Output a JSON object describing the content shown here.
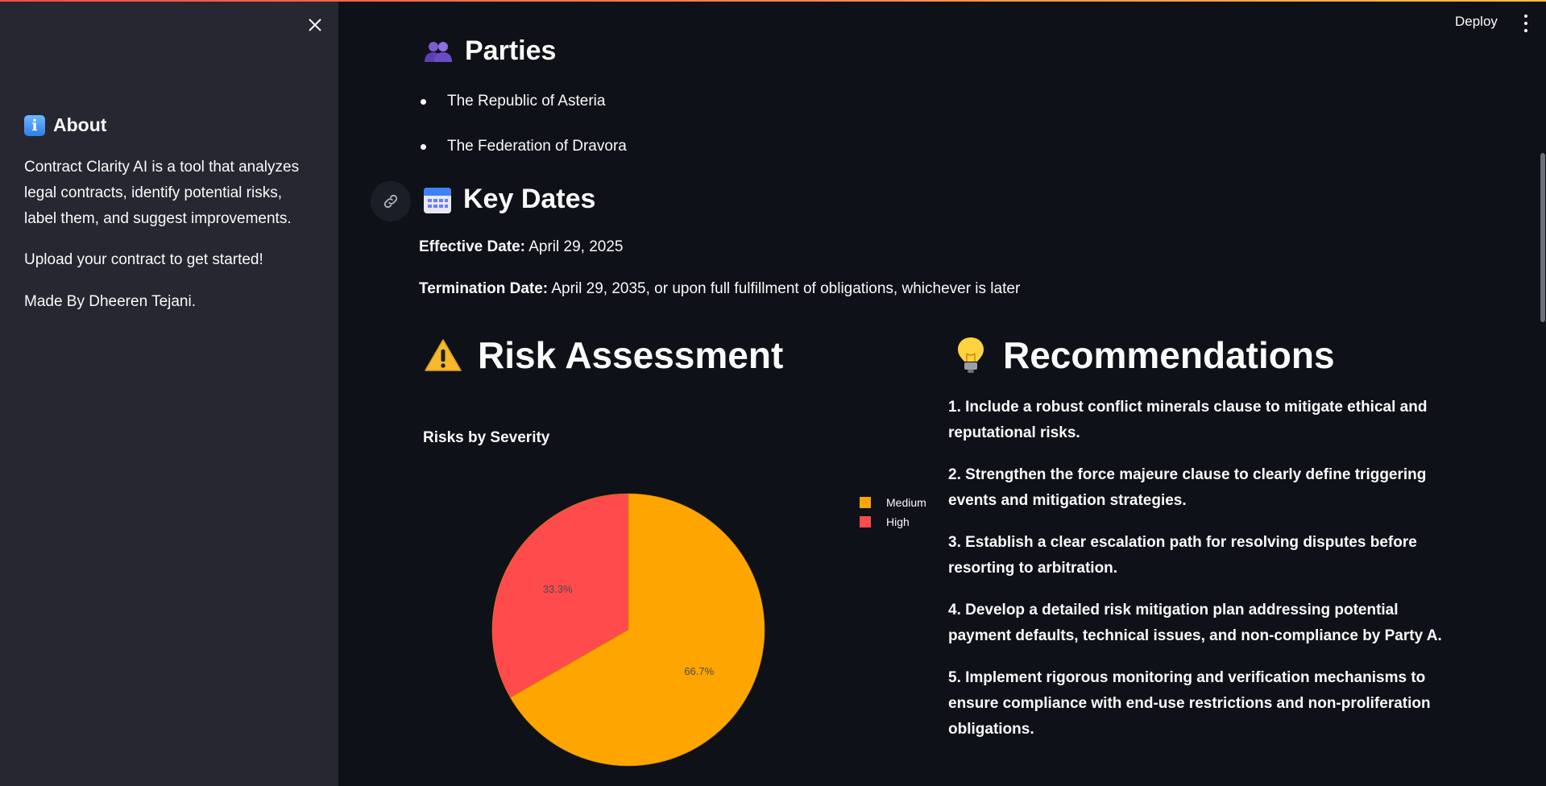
{
  "header": {
    "deploy_label": "Deploy"
  },
  "sidebar": {
    "about_title": "About",
    "description": "Contract Clarity AI is a tool that analyzes legal contracts, identify potential risks, label them, and suggest improvements.",
    "cta": "Upload your contract to get started!",
    "credit": "Made By Dheeren Tejani."
  },
  "parties": {
    "title": "Parties",
    "items": [
      "The Republic of Asteria",
      "The Federation of Dravora"
    ]
  },
  "key_dates": {
    "title": "Key Dates",
    "effective_label": "Effective Date:",
    "effective_value": "April 29, 2025",
    "termination_label": "Termination Date:",
    "termination_value": "April 29, 2035, or upon full fulfillment of obligations, whichever is later"
  },
  "risk": {
    "title": "Risk Assessment"
  },
  "recommendations": {
    "title": "Recommendations",
    "items": [
      "1. Include a robust conflict minerals clause to mitigate ethical and reputational risks.",
      "2. Strengthen the force majeure clause to clearly define triggering events and mitigation strategies.",
      "3. Establish a clear escalation path for resolving disputes before resorting to arbitration.",
      "4. Develop a detailed risk mitigation plan addressing potential payment defaults, technical issues, and non-compliance by Party A.",
      "5. Implement rigorous monitoring and verification mechanisms to ensure compliance with end-use restrictions and non-proliferation obligations."
    ]
  },
  "chart_data": {
    "type": "pie",
    "title": "Risks by Severity",
    "categories": [
      "Medium",
      "High"
    ],
    "values": [
      66.7,
      33.3
    ],
    "labels": [
      "66.7%",
      "33.3%"
    ],
    "colors": [
      "#ffa500",
      "#ff4b4b"
    ],
    "legend": "right"
  },
  "icons": {
    "parties": "people-icon",
    "key_dates": "calendar-icon",
    "risk": "warning-icon",
    "recommendations": "lightbulb-icon",
    "about": "info-icon"
  }
}
